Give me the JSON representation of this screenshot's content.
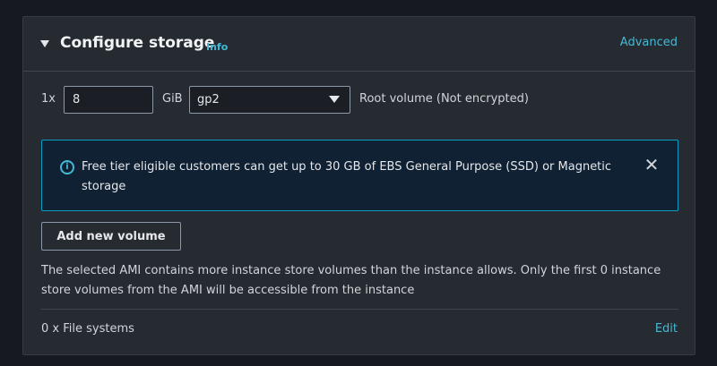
{
  "panel": {
    "title": "Configure storage",
    "info_label": "Info",
    "advanced_label": "Advanced"
  },
  "volume": {
    "multiplier": "1x",
    "size_value": "8",
    "unit": "GiB",
    "type_selected": "gp2",
    "root_label": "Root volume  (Not encrypted)"
  },
  "alert": {
    "text": "Free tier eligible customers can get up to 30 GB of EBS General Purpose (SSD) or Magnetic storage",
    "icon": "info-icon",
    "close_icon": "close-icon"
  },
  "actions": {
    "add_volume_label": "Add new volume"
  },
  "note": "The selected AMI contains more instance store volumes than the instance allows. Only the first 0 instance store volumes from the AMI will be accessible from the instance",
  "file_systems": {
    "label": "0 x File systems",
    "edit_label": "Edit"
  },
  "colors": {
    "accent": "#44b9d6",
    "alert_border": "#0b9ec5",
    "alert_bg": "#0f2133",
    "panel_bg": "#262a31",
    "page_bg": "#16191f"
  }
}
